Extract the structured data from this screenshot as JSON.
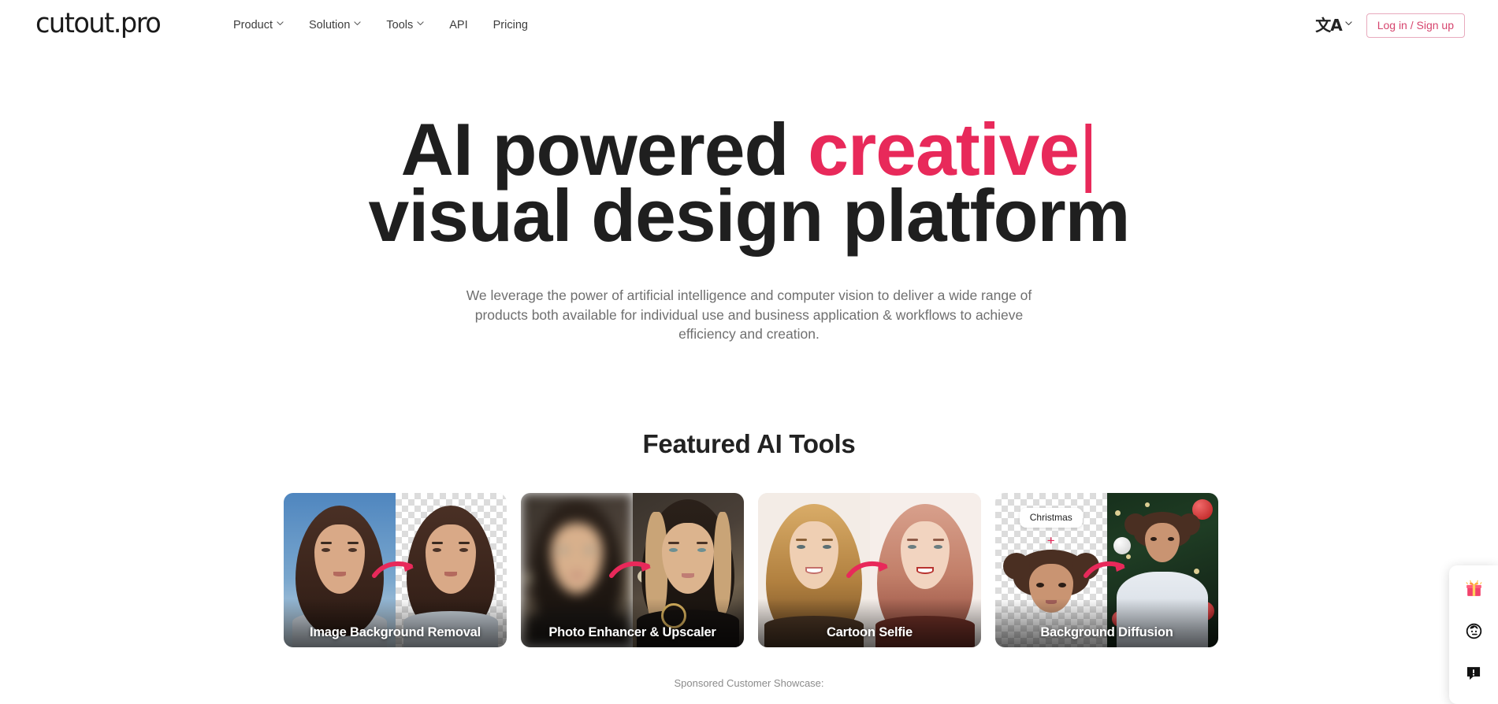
{
  "brand": {
    "logo_text": "cutout.pro",
    "accent_color": "#e8295a",
    "text_color": "#1f1f1f"
  },
  "header": {
    "nav": [
      {
        "label": "Product",
        "has_dropdown": true
      },
      {
        "label": "Solution",
        "has_dropdown": true
      },
      {
        "label": "Tools",
        "has_dropdown": true
      },
      {
        "label": "API",
        "has_dropdown": false
      },
      {
        "label": "Pricing",
        "has_dropdown": false
      }
    ],
    "language_icon": "translate-icon",
    "language_glyph": "文A",
    "login_label": "Log in / Sign up"
  },
  "hero": {
    "headline_part1": "AI powered ",
    "headline_accent": "creative",
    "headline_caret": "|",
    "headline_line2": "visual design platform",
    "subtitle": "We leverage the power of artificial intelligence and computer vision to deliver a wide range of products both available for individual use and business application & workflows to achieve efficiency and creation."
  },
  "featured": {
    "title": "Featured AI Tools",
    "cards": [
      {
        "label": "Image Background Removal",
        "kind": "before-after"
      },
      {
        "label": "Photo Enhancer & Upscaler",
        "kind": "before-after"
      },
      {
        "label": "Cartoon Selfie",
        "kind": "before-after"
      },
      {
        "label": "Background Diffusion",
        "kind": "prompt",
        "prompt_chip": "Christmas",
        "plus": "+"
      }
    ]
  },
  "sponsored": {
    "label": "Sponsored Customer Showcase:"
  },
  "side_widget": {
    "items": [
      {
        "name": "gift-icon",
        "glyph": "🎁"
      },
      {
        "name": "customer-service-icon",
        "glyph": ""
      },
      {
        "name": "feedback-icon",
        "glyph": ""
      }
    ]
  }
}
